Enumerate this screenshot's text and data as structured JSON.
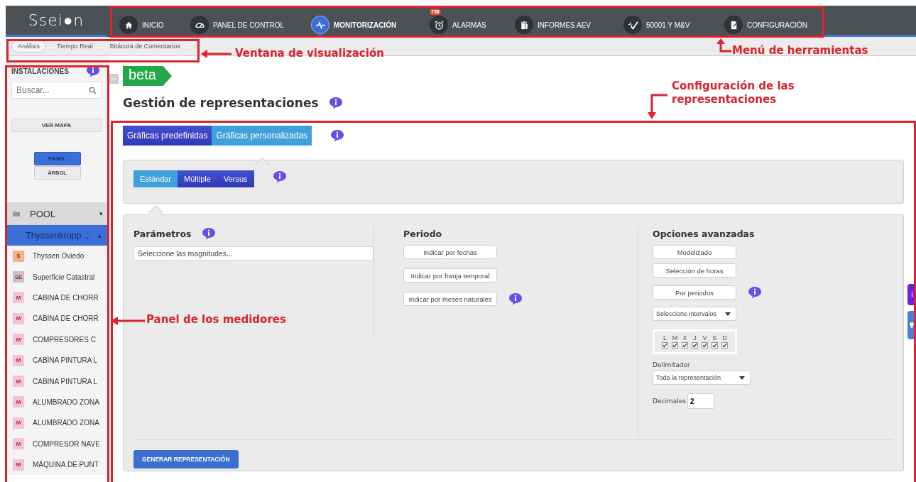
{
  "logo": "Ssei●n",
  "nav": {
    "items": [
      {
        "label": "INICIO",
        "selected": false
      },
      {
        "label": "PANEL DE CONTROL",
        "selected": false
      },
      {
        "label": "MONITORIZACIÓN",
        "selected": true
      },
      {
        "label": "ALARMAS",
        "selected": false,
        "badge": "758"
      },
      {
        "label": "INFORMES AEV",
        "selected": false
      },
      {
        "label": "50001 Y M&V",
        "selected": false
      },
      {
        "label": "CONFIGURACIÓN",
        "selected": false
      }
    ]
  },
  "subtabs": [
    {
      "label": "Análisis",
      "selected": true
    },
    {
      "label": "Tiempo Real",
      "selected": false
    },
    {
      "label": "Bitácora de Comentarios",
      "selected": false
    }
  ],
  "sidebar": {
    "title": "INSTALACIONES",
    "search": {
      "placeholder": "Buscar..."
    },
    "map_button": "VER MAPA",
    "view_toggle": [
      {
        "label": "PANEL",
        "selected": true
      },
      {
        "label": "ÁRBOL",
        "selected": false
      }
    ],
    "tree": {
      "label": "POOL",
      "caret": "▾",
      "children": [
        {
          "label": "Thyssenkrupp ...",
          "caret": "▴",
          "selected": true,
          "children": [
            {
              "tag": "S",
              "color": "#f4b08f",
              "label": "Thyssen Oviedo"
            },
            {
              "tag": "SE",
              "color": "#c4c4c4",
              "label": "Superficie Catastral"
            },
            {
              "tag": "M",
              "color": "#f6c3d2",
              "label": "CABINA DE CHORR"
            },
            {
              "tag": "M",
              "color": "#f6c3d2",
              "label": "CABINA DE CHORR"
            },
            {
              "tag": "M",
              "color": "#f6c3d2",
              "label": "COMPRESORES C"
            },
            {
              "tag": "M",
              "color": "#f6c3d2",
              "label": "CABINA PINTURA L"
            },
            {
              "tag": "M",
              "color": "#f6c3d2",
              "label": "CABINA PINTURA L"
            },
            {
              "tag": "M",
              "color": "#f6c3d2",
              "label": "ALUMBRADO ZONA"
            },
            {
              "tag": "M",
              "color": "#f6c3d2",
              "label": "ALUMBRADO ZONA"
            },
            {
              "tag": "M",
              "color": "#f6c3d2",
              "label": "COMPRESOR NAVE"
            },
            {
              "tag": "M",
              "color": "#f6c3d2",
              "label": "MÁQUINA DE PUNT"
            }
          ]
        }
      ]
    }
  },
  "main": {
    "badge": "beta",
    "title": "Gestión de representaciones",
    "chart_tabs": [
      {
        "label": "Gráficas predefinidas",
        "selected": false
      },
      {
        "label": "Gráficas personalizadas",
        "selected": true
      }
    ],
    "mode_tabs": [
      {
        "label": "Estándar",
        "selected": true
      },
      {
        "label": "Múltiple",
        "selected": false
      },
      {
        "label": "Versus",
        "selected": false
      }
    ],
    "parameters": {
      "heading": "Parámetros",
      "field": {
        "placeholder": "Seleccione las magnitudes..."
      }
    },
    "period": {
      "heading": "Periodo",
      "buttons": [
        "Indicar por fechas",
        "Indicar por franja temporal",
        "Indicar por meses naturales"
      ]
    },
    "advanced": {
      "heading": "Opciones avanzadas",
      "buttons": [
        "Modelizado",
        "Selección de horas",
        "Por periodos"
      ],
      "interval_select": "Seleccione intervalos",
      "days": [
        {
          "label": "L",
          "checked": true
        },
        {
          "label": "M",
          "checked": true
        },
        {
          "label": "X",
          "checked": true
        },
        {
          "label": "J",
          "checked": true
        },
        {
          "label": "V",
          "checked": true
        },
        {
          "label": "S",
          "checked": true
        },
        {
          "label": "D",
          "checked": true
        }
      ],
      "delimiter": {
        "label": "Delimitador",
        "value": "Toda la representación"
      },
      "decimals": {
        "label": "Decimales",
        "value": "2"
      }
    },
    "generate_button": "GENERAR REPRESENTACIÓN"
  },
  "annotations": [
    {
      "text": "Ventana de visualización"
    },
    {
      "text": "Menú de herramientas"
    },
    {
      "text": "Panel de los medidores"
    },
    {
      "text": "Configuración de las representaciones"
    }
  ]
}
